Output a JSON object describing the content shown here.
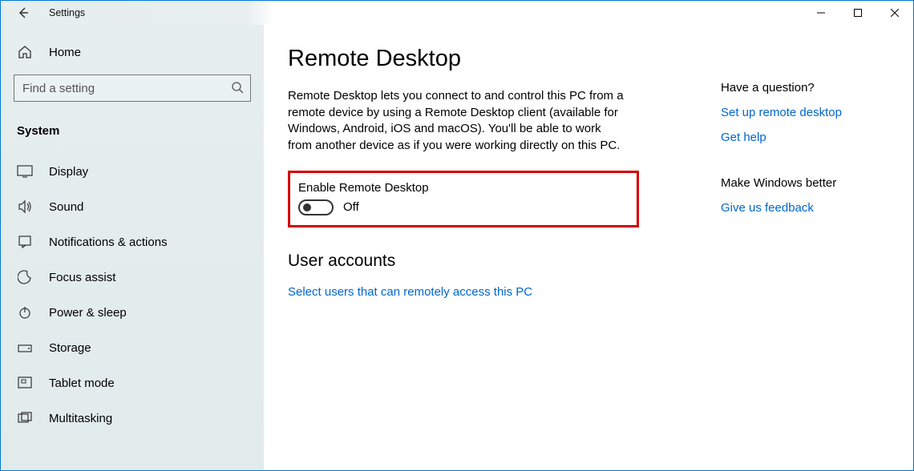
{
  "window": {
    "title": "Settings"
  },
  "sidebar": {
    "home": "Home",
    "search_placeholder": "Find a setting",
    "category": "System",
    "items": [
      {
        "label": "Display"
      },
      {
        "label": "Sound"
      },
      {
        "label": "Notifications & actions"
      },
      {
        "label": "Focus assist"
      },
      {
        "label": "Power & sleep"
      },
      {
        "label": "Storage"
      },
      {
        "label": "Tablet mode"
      },
      {
        "label": "Multitasking"
      }
    ]
  },
  "main": {
    "title": "Remote Desktop",
    "description": "Remote Desktop lets you connect to and control this PC from a remote device by using a Remote Desktop client (available for Windows, Android, iOS and macOS). You'll be able to work from another device as if you were working directly on this PC.",
    "enable_label": "Enable Remote Desktop",
    "toggle_state": "Off",
    "accounts_heading": "User accounts",
    "accounts_link": "Select users that can remotely access this PC"
  },
  "aside": {
    "q_heading": "Have a question?",
    "link_setup": "Set up remote desktop",
    "link_help": "Get help",
    "better_heading": "Make Windows better",
    "link_feedback": "Give us feedback"
  }
}
